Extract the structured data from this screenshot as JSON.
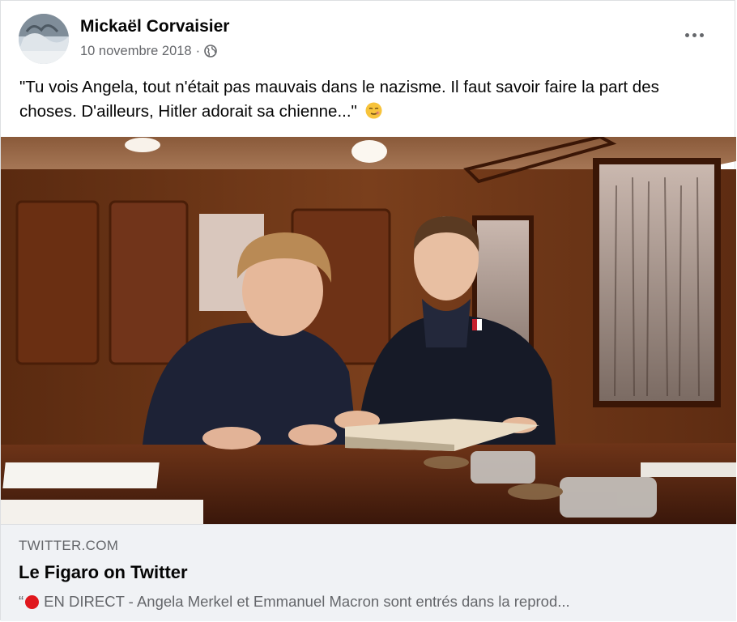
{
  "post": {
    "author": "Mickaël Corvaisier",
    "date": "10 novembre 2018",
    "separator": "·",
    "audience_icon": "globe-icon",
    "more_icon": "more-options-icon",
    "text": "\"Tu vois Angela, tout n'était pas mauvais dans le nazisme. Il faut savoir faire la part des choses. D'ailleurs, Hitler adorait sa chienne...\"",
    "emoji": "smirk-face-emoji"
  },
  "link_preview": {
    "domain": "TWITTER.COM",
    "title": "Le Figaro on Twitter",
    "quote_mark": "“",
    "live_icon": "red-circle-icon",
    "description": "EN DIRECT - Angela Merkel et Emmanuel Macron sont entrés dans la reprod..."
  },
  "colors": {
    "text_primary": "#050505",
    "text_secondary": "#65676b",
    "link_bg": "#f0f2f5",
    "live_red": "#e0171d",
    "wood": "#6b3a1c"
  }
}
